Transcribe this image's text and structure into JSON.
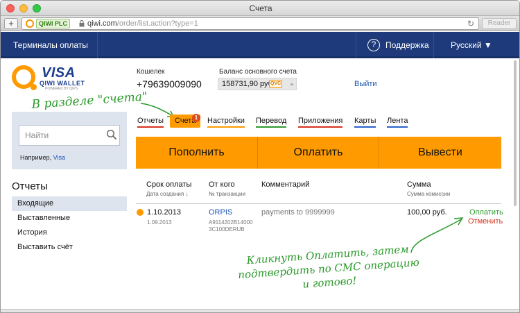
{
  "browser": {
    "title": "Счета",
    "secure_label": "QIWI PLC",
    "url_host": "qiwi.com",
    "url_path": "/order/list.action?type=1",
    "reader_label": "Reader",
    "add_label": "+"
  },
  "topnav": {
    "terminals": "Терминалы оплаты",
    "support": "Поддержка",
    "language": "Русский ▼",
    "help_glyph": "?"
  },
  "logo": {
    "visa": "VISA",
    "wallet": "QIWI WALLET",
    "powered": "POWERED BY QIPS"
  },
  "account": {
    "wallet_label": "Кошелек",
    "wallet_number": "+79639009090",
    "balance_label": "Баланс основного счета",
    "balance_value": "158731,90 руб.",
    "currency_tag": "QVC",
    "logout": "Выйти"
  },
  "annotations": {
    "top": "В разделе \"счета\"",
    "bottom": "Кликнуть Оплатить, затем подтвердить по СМС операцию и готово!"
  },
  "tabs": [
    {
      "label": "Отчеты",
      "underline": "#d8311e"
    },
    {
      "label": "Счета",
      "badge": "1"
    },
    {
      "label": "Настройки",
      "underline": "#ff9b00"
    },
    {
      "label": "Перевод",
      "underline": "#2f9a2f"
    },
    {
      "label": "Приложения",
      "underline": "#d8311e"
    },
    {
      "label": "Карты",
      "underline": "#2a62c9"
    },
    {
      "label": "Лента",
      "underline": "#2a62c9"
    }
  ],
  "search": {
    "placeholder": "Найти",
    "hint_prefix": "Например,",
    "hint_link": "Visa"
  },
  "sidebar": {
    "title": "Отчеты",
    "items": [
      "Входящие",
      "Выставленные",
      "История",
      "Выставить счёт"
    ],
    "active_index": 0
  },
  "actions": {
    "topup": "Пополнить",
    "pay": "Оплатить",
    "withdraw": "Вывести"
  },
  "table": {
    "headers": [
      {
        "title": "Срок оплаты",
        "sub": "Дата создания ↓"
      },
      {
        "title": "От кого",
        "sub": "№ транзакции"
      },
      {
        "title": "Комментарий",
        "sub": ""
      },
      {
        "title": "Сумма",
        "sub": "Сумма комиссии"
      }
    ],
    "rows": [
      {
        "due_date": "1.10.2013",
        "created": "1.09.2013",
        "from": "ORPIS",
        "transaction_line1": "A9114202B14000",
        "transaction_line2": "3C100DERUB",
        "comment": "payments to 9999999",
        "amount": "100,00 руб.",
        "action_pay": "Оплатить",
        "action_cancel": "Отменить"
      }
    ]
  },
  "colors": {
    "nav_bg": "#1e3a7a",
    "accent_orange": "#ff9b00",
    "link_blue": "#1b55b0",
    "annotation_green": "#2a9a2a"
  }
}
